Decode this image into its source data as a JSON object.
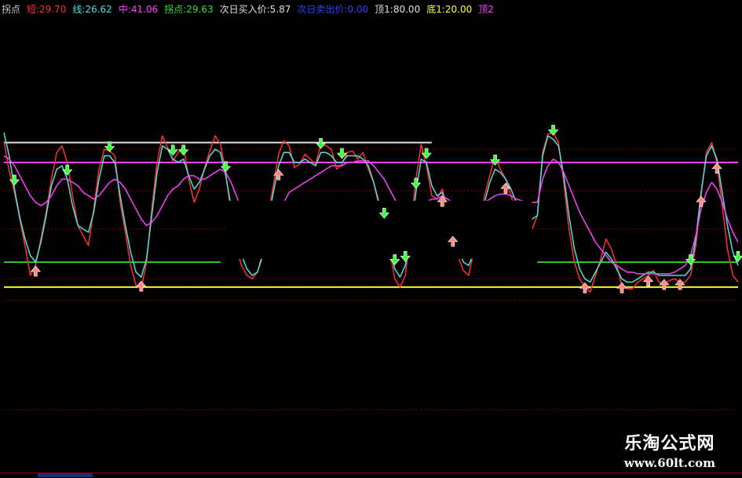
{
  "header": {
    "title": "拐点",
    "short_label": "短:29.70",
    "line_label": "线:26.62",
    "mid_label": "中:41.06",
    "pivot_label": "拐点:29.63",
    "buy_label": "次日买入价:5.87",
    "sell_label": "次日卖出价:0.00",
    "top_label": "顶1:80.00",
    "bottom_label": "底1:20.00",
    "top2_label": "顶2"
  },
  "colors": {
    "background": "#000000",
    "title": "#c8c8c8",
    "short": "#ff3030",
    "line": "#50e0e0",
    "mid": "#ff40ff",
    "pivot": "#30e030",
    "buy": "#e0e0e0",
    "sell": "#3040ff",
    "top": "#e0e0e0",
    "bottom": "#ffff40",
    "top2": "#ff40ff",
    "grid": "#8a0000",
    "signal_down": "#40ff40",
    "signal_up": "#ff8a80"
  },
  "chart_data": {
    "type": "line",
    "ylim": [
      0,
      100
    ],
    "x_count": 140,
    "reference_lines": [
      {
        "name": "top2",
        "value": 92,
        "color": "#e0e0e0",
        "x_range": [
          0,
          81
        ]
      },
      {
        "name": "top",
        "value": 80,
        "color": "#ff40ff",
        "x_range": [
          0,
          139
        ]
      },
      {
        "name": "bottom",
        "value": 20,
        "color": "#30c030",
        "x_range": [
          0,
          41
        ]
      },
      {
        "name": "bottom-right",
        "value": 20,
        "color": "#30c030",
        "x_range": [
          101,
          139
        ]
      },
      {
        "name": "floor",
        "value": 5,
        "color": "#ffff40",
        "x_range": [
          0,
          139
        ]
      }
    ],
    "grid_values": [
      88,
      63,
      40,
      10,
      -3
    ],
    "gap": {
      "x_range": [
        42,
        100
      ],
      "y_range": [
        22,
        57
      ]
    },
    "series": [
      {
        "key": "short",
        "color": "#ff3030",
        "values": [
          93,
          75,
          62,
          46,
          30,
          12,
          18,
          34,
          50,
          70,
          86,
          90,
          80,
          60,
          42,
          36,
          30,
          52,
          76,
          88,
          87,
          84,
          56,
          38,
          18,
          6,
          4,
          20,
          52,
          80,
          96,
          89,
          81,
          86,
          90,
          70,
          56,
          64,
          77,
          87,
          96,
          91,
          74,
          49,
          28,
          18,
          12,
          10,
          14,
          26,
          48,
          66,
          85,
          93,
          90,
          77,
          79,
          85,
          82,
          79,
          91,
          90,
          88,
          76,
          79,
          86,
          87,
          82,
          86,
          76,
          68,
          54,
          47,
          28,
          10,
          5,
          12,
          40,
          70,
          91,
          78,
          60,
          58,
          64,
          52,
          35,
          23,
          15,
          12,
          27,
          44,
          60,
          72,
          84,
          76,
          70,
          60,
          50,
          40,
          40,
          40,
          48,
          86,
          97,
          98,
          92,
          68,
          40,
          20,
          10,
          5,
          2,
          12,
          22,
          34,
          28,
          18,
          6,
          4,
          4,
          8,
          10,
          12,
          15,
          8,
          7,
          9,
          10,
          8,
          8,
          12,
          30,
          60,
          86,
          92,
          80,
          54,
          28,
          12,
          8
        ]
      },
      {
        "key": "line",
        "color": "#50e0e0",
        "values": [
          98,
          84,
          64,
          47,
          34,
          24,
          20,
          32,
          48,
          66,
          76,
          78,
          70,
          54,
          42,
          40,
          38,
          50,
          70,
          84,
          84,
          80,
          60,
          42,
          26,
          14,
          11,
          22,
          48,
          74,
          90,
          88,
          82,
          80,
          82,
          72,
          64,
          68,
          76,
          84,
          88,
          86,
          72,
          54,
          36,
          24,
          16,
          12,
          14,
          24,
          44,
          62,
          78,
          86,
          86,
          80,
          80,
          82,
          80,
          78,
          86,
          86,
          84,
          80,
          80,
          84,
          84,
          84,
          82,
          78,
          68,
          56,
          44,
          30,
          16,
          11,
          18,
          38,
          62,
          82,
          80,
          66,
          60,
          62,
          52,
          38,
          28,
          20,
          18,
          26,
          40,
          56,
          68,
          76,
          74,
          70,
          64,
          56,
          48,
          46,
          46,
          48,
          84,
          96,
          94,
          90,
          72,
          48,
          28,
          16,
          10,
          8,
          14,
          20,
          26,
          22,
          16,
          10,
          8,
          8,
          10,
          12,
          14,
          14,
          12,
          12,
          12,
          12,
          12,
          12,
          16,
          34,
          62,
          84,
          90,
          82,
          62,
          42,
          26,
          18
        ]
      },
      {
        "key": "mid",
        "color": "#ff40ff",
        "values": [
          84,
          82,
          78,
          72,
          66,
          60,
          56,
          54,
          56,
          60,
          66,
          70,
          70,
          68,
          66,
          62,
          60,
          58,
          60,
          64,
          68,
          70,
          68,
          64,
          58,
          52,
          46,
          42,
          44,
          48,
          54,
          60,
          64,
          66,
          70,
          72,
          72,
          70,
          70,
          72,
          74,
          76,
          74,
          68,
          60,
          52,
          44,
          38,
          34,
          32,
          34,
          40,
          48,
          56,
          62,
          64,
          66,
          68,
          70,
          72,
          74,
          76,
          78,
          78,
          78,
          80,
          80,
          81,
          81,
          81,
          78,
          74,
          70,
          64,
          58,
          52,
          48,
          46,
          48,
          52,
          56,
          58,
          58,
          60,
          58,
          56,
          54,
          52,
          52,
          52,
          54,
          56,
          58,
          60,
          61,
          61,
          60,
          58,
          57,
          56,
          56,
          56,
          70,
          78,
          82,
          80,
          74,
          66,
          58,
          50,
          44,
          38,
          32,
          28,
          24,
          20,
          18,
          16,
          14,
          14,
          13,
          13,
          13,
          13,
          13,
          13,
          13,
          14,
          16,
          18,
          24,
          36,
          52,
          62,
          68,
          64,
          56,
          46,
          38,
          32
        ]
      }
    ],
    "signals_down": [
      2,
      12,
      20,
      32,
      34,
      42,
      60,
      64,
      72,
      74,
      76,
      78,
      80,
      93,
      104,
      130,
      143
    ],
    "signals_up": [
      6,
      26,
      52,
      83,
      85,
      95,
      110,
      117,
      122,
      125,
      128,
      132,
      135
    ]
  },
  "watermark": {
    "title": "乐淘公式网",
    "url": "www.60lt.com"
  }
}
